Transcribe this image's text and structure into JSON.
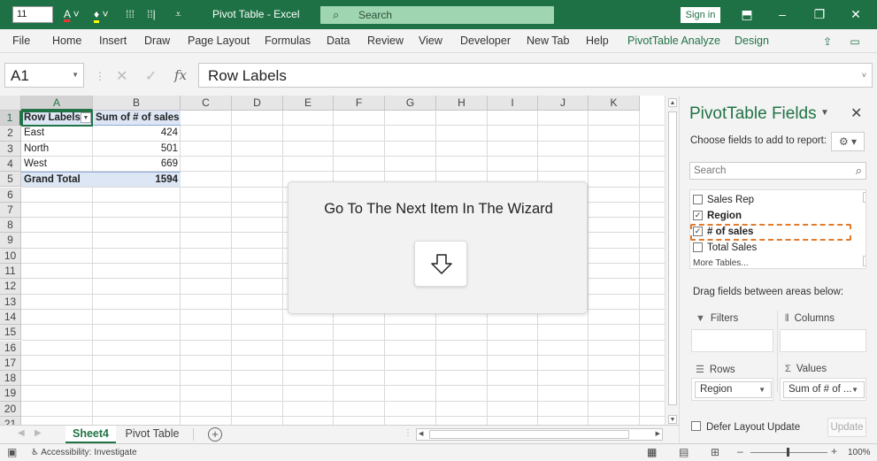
{
  "titlebar": {
    "font_size_value": "11",
    "title": "Pivot Table  -  Excel",
    "search_label": "Search",
    "signin_label": "Sign in"
  },
  "menu": {
    "items": [
      "File",
      "Home",
      "Insert",
      "Draw",
      "Page Layout",
      "Formulas",
      "Data",
      "Review",
      "View",
      "Developer",
      "New Tab",
      "Help"
    ],
    "contextual": [
      "PivotTable Analyze",
      "Design"
    ]
  },
  "formula_bar": {
    "name_box": "A1",
    "fx": "fx",
    "value": "Row Labels"
  },
  "grid": {
    "columns": [
      "A",
      "B",
      "C",
      "D",
      "E",
      "F",
      "G",
      "H",
      "I",
      "J",
      "K"
    ],
    "rows": [
      "1",
      "2",
      "3",
      "4",
      "5",
      "6",
      "7",
      "8",
      "9",
      "10",
      "11",
      "12",
      "13",
      "14",
      "15",
      "16",
      "17",
      "18",
      "19",
      "20",
      "21"
    ],
    "pivot": {
      "header_col_a": "Row Labels",
      "header_col_b": "Sum of # of sales",
      "rows": [
        {
          "label": "East",
          "value": "424"
        },
        {
          "label": "North",
          "value": "501"
        },
        {
          "label": "West",
          "value": "669"
        }
      ],
      "total_label": "Grand Total",
      "total_value": "1594"
    }
  },
  "wizard": {
    "text": "Go To The Next Item In The Wizard",
    "button_icon": "arrow-down-outline-icon"
  },
  "sheet_tabs": {
    "active": "Sheet4",
    "other": "Pivot Table"
  },
  "pivot_panel": {
    "title": "PivotTable Fields",
    "choose_text": "Choose fields to add to report:",
    "search_placeholder": "Search",
    "fields": [
      {
        "label": "Sales Rep",
        "checked": false,
        "bold": false
      },
      {
        "label": "Region",
        "checked": true,
        "bold": true
      },
      {
        "label": "# of sales",
        "checked": true,
        "bold": true
      },
      {
        "label": "Total Sales",
        "checked": false,
        "bold": false
      },
      {
        "label": "More Tables...",
        "checked": false,
        "bold": false
      }
    ],
    "drag_text": "Drag fields between areas below:",
    "areas": {
      "filters": "Filters",
      "columns": "Columns",
      "rows": "Rows",
      "values": "Values",
      "rows_item": "Region",
      "values_item": "Sum of # of ..."
    },
    "defer_label": "Defer Layout Update",
    "update_label": "Update"
  },
  "statusbar": {
    "accessibility": "Accessibility: Investigate",
    "zoom": "100%"
  },
  "colors": {
    "excel_green": "#217346",
    "title_bar": "#1e7145",
    "pivot_header_bg": "#dce6f4",
    "focus_outline": "#e07b2e"
  }
}
